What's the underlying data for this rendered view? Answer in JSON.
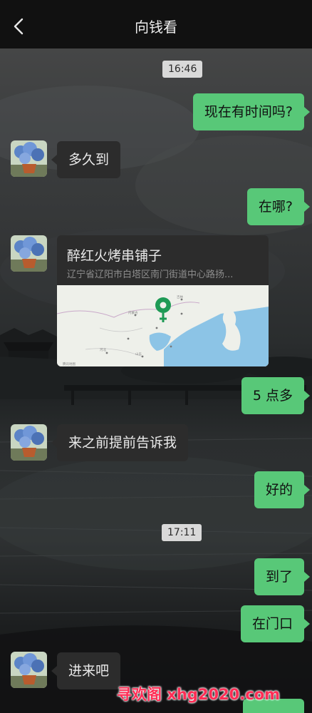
{
  "header": {
    "title": "向钱看",
    "back_icon": "chevron-left-icon"
  },
  "colors": {
    "outgoing_bubble": "#58c878",
    "incoming_bubble": "#2c2c2c",
    "header_bg": "#111111"
  },
  "messages": {
    "ts1": "16:46",
    "m1": "现在有时间吗?",
    "m2": "多久到",
    "m3": "在哪?",
    "location": {
      "name": "醉红火烤串铺子",
      "address": "辽宁省辽阳市白塔区南门街道中心路扬...",
      "map_icon": "location-pin-icon"
    },
    "m4": "5 点多",
    "m5": "来之前提前告诉我",
    "m6": "好的",
    "ts2": "17:11",
    "m7": "到了",
    "m8": "在门口",
    "m9": "进来吧"
  },
  "watermark": "寻欢阁 xhg2020.com"
}
